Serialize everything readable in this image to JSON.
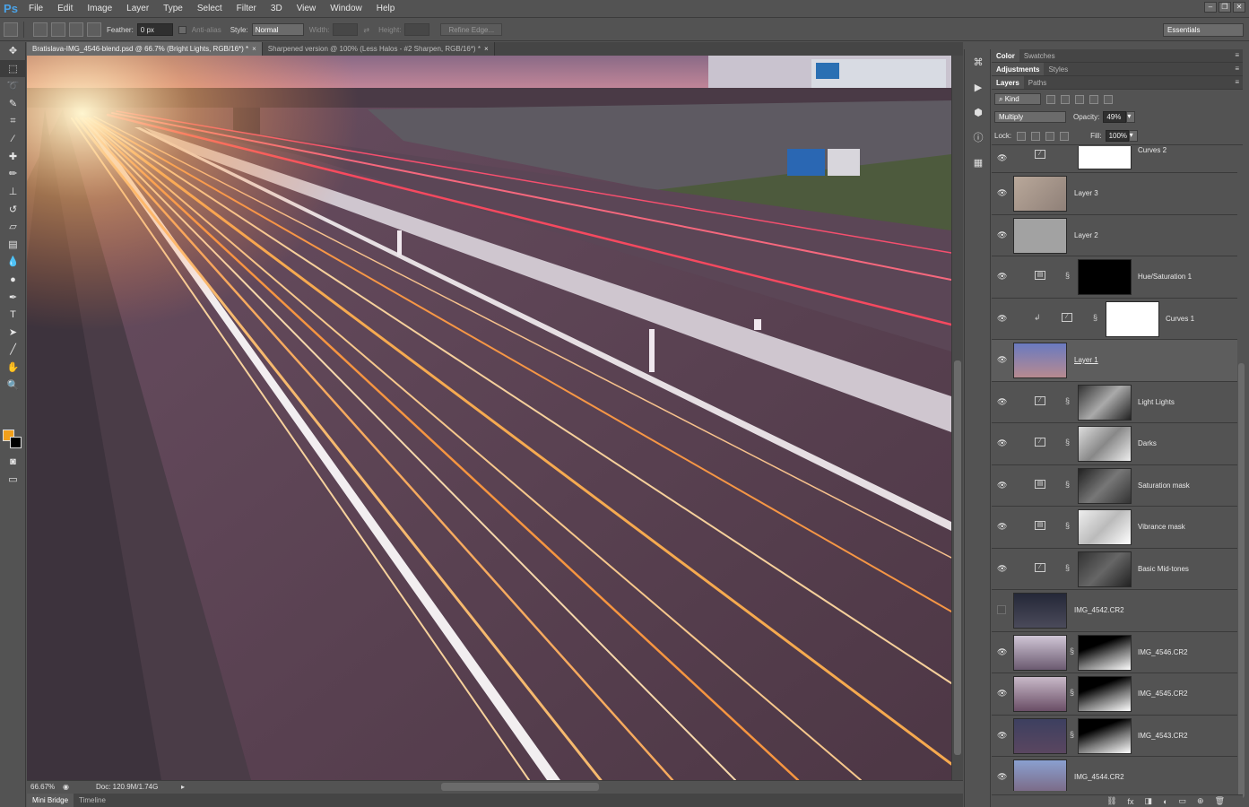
{
  "app": {
    "logo": "Ps"
  },
  "menu": [
    "File",
    "Edit",
    "Image",
    "Layer",
    "Type",
    "Select",
    "Filter",
    "3D",
    "View",
    "Window",
    "Help"
  ],
  "window_controls": [
    "minimize-icon",
    "restore-icon",
    "close-icon"
  ],
  "options": {
    "feather_label": "Feather:",
    "feather_value": "0 px",
    "antialias_label": "Anti-alias",
    "style_label": "Style:",
    "style_value": "Normal",
    "width_label": "Width:",
    "height_label": "Height:",
    "refine_edge": "Refine Edge...",
    "workspace": "Essentials"
  },
  "doc_tabs": [
    {
      "label": "Bratislava-IMG_4546-blend.psd @ 66.7% (Bright Lights, RGB/16*) *",
      "active": true
    },
    {
      "label": "Sharpened version @ 100% (Less Halos - #2 Sharpen, RGB/16*) *",
      "active": false
    }
  ],
  "status": {
    "zoom": "66.67%",
    "doc": "Doc: 120.9M/1.74G"
  },
  "bottom_tabs": [
    "Mini Bridge",
    "Timeline"
  ],
  "panels": {
    "group1": [
      "Color",
      "Swatches"
    ],
    "group2": [
      "Adjustments",
      "Styles"
    ],
    "group3": [
      "Layers",
      "Paths"
    ]
  },
  "layers_controls": {
    "kind": "Kind",
    "blend_mode": "Multiply",
    "opacity_label": "Opacity:",
    "opacity_value": "49%",
    "lock_label": "Lock:",
    "fill_label": "Fill:",
    "fill_value": "100%"
  },
  "layers": [
    {
      "name": "Curves 2",
      "visible": true,
      "kind": "adjustment"
    },
    {
      "name": "Layer 3",
      "visible": true,
      "kind": "pixel"
    },
    {
      "name": "Layer 2",
      "visible": true,
      "kind": "pixel"
    },
    {
      "name": "Hue/Saturation 1",
      "visible": true,
      "kind": "adjustment"
    },
    {
      "name": "Curves 1",
      "visible": true,
      "kind": "adjustment-clipped"
    },
    {
      "name": "Layer 1",
      "visible": true,
      "kind": "pixel",
      "selected": true
    },
    {
      "name": "Light Lights",
      "visible": true,
      "kind": "adjustment"
    },
    {
      "name": "Darks",
      "visible": true,
      "kind": "adjustment"
    },
    {
      "name": "Saturation mask",
      "visible": true,
      "kind": "adjustment"
    },
    {
      "name": "Vibrance mask",
      "visible": true,
      "kind": "adjustment"
    },
    {
      "name": "Basic Mid-tones",
      "visible": true,
      "kind": "adjustment"
    },
    {
      "name": "IMG_4542.CR2",
      "visible": false,
      "kind": "pixel"
    },
    {
      "name": "IMG_4546.CR2",
      "visible": true,
      "kind": "masked"
    },
    {
      "name": "IMG_4545.CR2",
      "visible": true,
      "kind": "masked"
    },
    {
      "name": "IMG_4543.CR2",
      "visible": true,
      "kind": "masked"
    },
    {
      "name": "IMG_4544.CR2",
      "visible": true,
      "kind": "pixel"
    }
  ],
  "colors": {
    "foreground": "#f2a01b",
    "background": "#000000",
    "ui": "#535353"
  }
}
